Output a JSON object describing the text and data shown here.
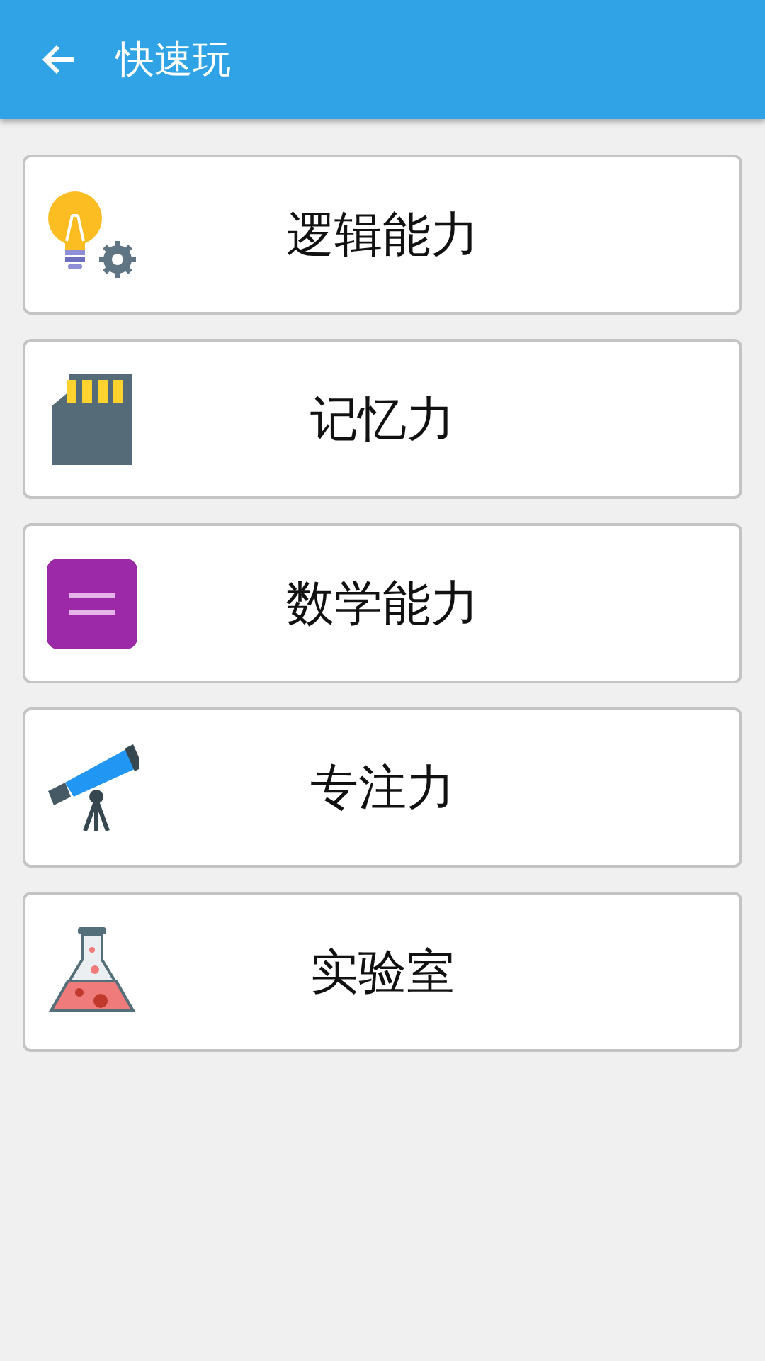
{
  "app_bar": {
    "title": "快速玩"
  },
  "items": [
    {
      "label": "逻辑能力"
    },
    {
      "label": "记忆力"
    },
    {
      "label": "数学能力"
    },
    {
      "label": "专注力"
    },
    {
      "label": "实验室"
    }
  ]
}
